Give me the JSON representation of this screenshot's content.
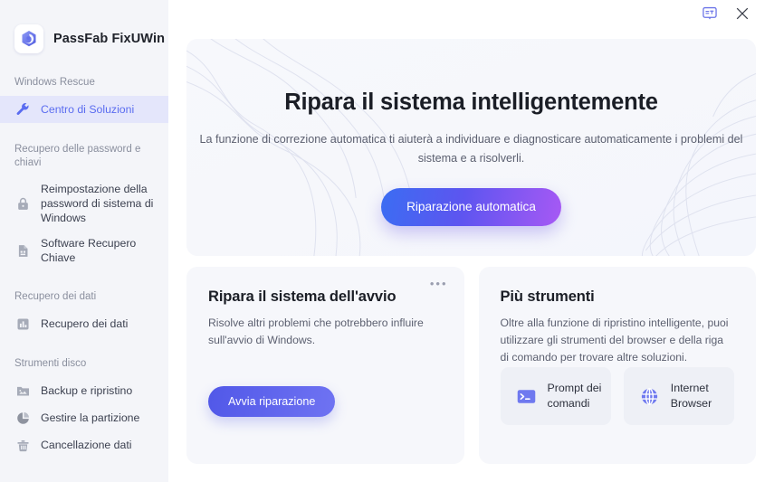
{
  "app": {
    "brand_name": "PassFab FixUWin",
    "logo_icon": "cube-logo-icon"
  },
  "titlebar": {
    "feedback_icon": "feedback-bubble-icon",
    "close_icon": "close-icon"
  },
  "sidebar": {
    "sections": [
      {
        "title": "Windows Rescue",
        "items": [
          {
            "label": "Centro di Soluzioni",
            "icon": "wrench-icon",
            "active": true
          }
        ]
      },
      {
        "title": "Recupero delle password e chiavi",
        "items": [
          {
            "label": "Reimpostazione della password di sistema di Windows",
            "icon": "lock-icon",
            "active": false
          },
          {
            "label": "Software Recupero Chiave",
            "icon": "document-key-icon",
            "active": false
          }
        ]
      },
      {
        "title": "Recupero dei dati",
        "items": [
          {
            "label": "Recupero dei dati",
            "icon": "bar-chart-icon",
            "active": false
          }
        ]
      },
      {
        "title": "Strumenti disco",
        "items": [
          {
            "label": "Backup e ripristino",
            "icon": "folder-image-icon",
            "active": false
          },
          {
            "label": "Gestire la partizione",
            "icon": "pie-chart-icon",
            "active": false
          },
          {
            "label": "Cancellazione dati",
            "icon": "trash-icon",
            "active": false
          }
        ]
      }
    ]
  },
  "hero": {
    "title": "Ripara il sistema intelligentemente",
    "subtitle": "La funzione di correzione automatica ti aiuterà a individuare e diagnosticare automaticamente i problemi del sistema e a risolverli.",
    "button_label": "Riparazione automatica"
  },
  "cards": {
    "boot_repair": {
      "title": "Ripara il sistema dell'avvio",
      "description": "Risolve altri problemi che potrebbero influire sull'avvio di Windows.",
      "button_label": "Avvia riparazione",
      "menu_icon": "more-options-icon",
      "menu_glyph": "•••"
    },
    "more_tools": {
      "title": "Più strumenti",
      "description": "Oltre alla funzione di ripristino intelligente, puoi utilizzare gli strumenti del browser e della riga di comando per trovare altre soluzioni.",
      "tools": [
        {
          "label": "Prompt dei comandi",
          "icon": "command-prompt-icon"
        },
        {
          "label": "Internet Browser",
          "icon": "globe-icon"
        }
      ]
    }
  },
  "colors": {
    "accent_blue": "#5a6cf0",
    "accent_purple": "#a759f4",
    "sidebar_bg": "#f4f5f9",
    "card_bg": "#f6f7fb",
    "active_item_bg": "#e4e6fb",
    "text_primary": "#1b1e26",
    "text_secondary": "#5c6070",
    "text_muted": "#8a8f9e"
  }
}
